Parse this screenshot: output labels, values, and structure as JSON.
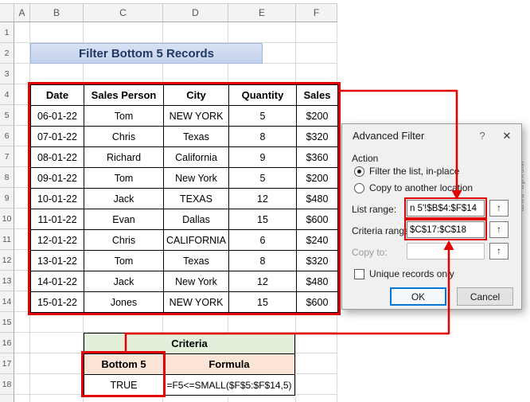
{
  "watermark": "wsxdn.com",
  "sheet": {
    "col_headers": [
      "A",
      "B",
      "C",
      "D",
      "E",
      "F"
    ],
    "row_headers": [
      "1",
      "2",
      "3",
      "4",
      "5",
      "6",
      "7",
      "8",
      "9",
      "10",
      "11",
      "12",
      "13",
      "14",
      "15",
      "16",
      "17",
      "18"
    ],
    "banner_title": "Filter Bottom 5 Records",
    "table": {
      "headers": [
        "Date",
        "Sales Person",
        "City",
        "Quantity",
        "Sales"
      ],
      "rows": [
        [
          "06-01-22",
          "Tom",
          "NEW YORK",
          "5",
          "$200"
        ],
        [
          "07-01-22",
          "Chris",
          "Texas",
          "8",
          "$320"
        ],
        [
          "08-01-22",
          "Richard",
          "California",
          "9",
          "$360"
        ],
        [
          "09-01-22",
          "Tom",
          "New York",
          "5",
          "$200"
        ],
        [
          "10-01-22",
          "Jack",
          "TEXAS",
          "12",
          "$480"
        ],
        [
          "11-01-22",
          "Evan",
          "Dallas",
          "15",
          "$600"
        ],
        [
          "12-01-22",
          "Chris",
          "CALIFORNIA",
          "6",
          "$240"
        ],
        [
          "13-01-22",
          "Tom",
          "Texas",
          "8",
          "$320"
        ],
        [
          "14-01-22",
          "Jack",
          "New York",
          "12",
          "$480"
        ],
        [
          "15-01-22",
          "Jones",
          "NEW YORK",
          "15",
          "$600"
        ]
      ]
    },
    "criteria": {
      "title": "Criteria",
      "col1_header": "Bottom 5",
      "col2_header": "Formula",
      "col1_value": "TRUE",
      "col2_value": "=F5<=SMALL($F$5:$F$14,5)"
    }
  },
  "dialog": {
    "title": "Advanced Filter",
    "help_icon": "?",
    "close_icon": "✕",
    "action_label": "Action",
    "radio_inplace": "Filter the list, in-place",
    "radio_copy": "Copy to another location",
    "list_range_label": "List range:",
    "list_range_value": "n 5'!$B$4:$F$14",
    "criteria_range_label": "Criteria range:",
    "criteria_range_value": "$C$17:$C$18",
    "copy_to_label": "Copy to:",
    "copy_to_value": "",
    "unique_label": "Unique records only",
    "ok_label": "OK",
    "cancel_label": "Cancel",
    "collapse_icon": "↑"
  }
}
